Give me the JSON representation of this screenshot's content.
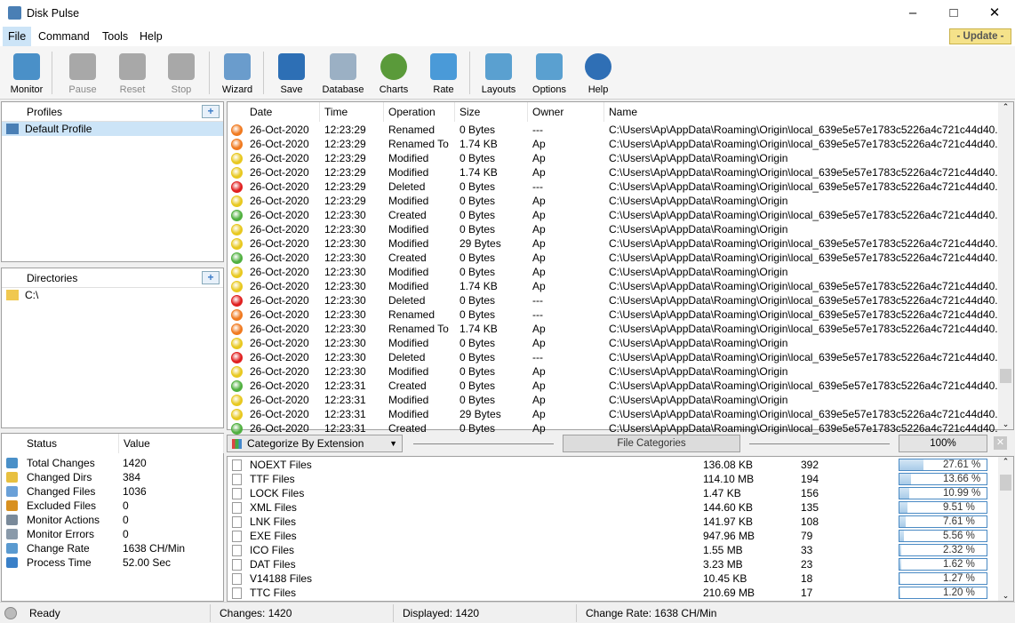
{
  "app": {
    "title": "Disk Pulse",
    "update_label": "- Update -"
  },
  "menu": [
    "File",
    "Command",
    "Tools",
    "Help"
  ],
  "toolbar": [
    {
      "label": "Monitor",
      "icon": "monitor-icon",
      "enabled": true,
      "color": "#4a90c8"
    },
    {
      "label": "Pause",
      "icon": "pause-icon",
      "enabled": false,
      "color": "#a8a8a8"
    },
    {
      "label": "Reset",
      "icon": "reset-icon",
      "enabled": false,
      "color": "#a8a8a8"
    },
    {
      "label": "Stop",
      "icon": "stop-icon",
      "enabled": false,
      "color": "#a8a8a8"
    },
    {
      "label": "Wizard",
      "icon": "wizard-icon",
      "enabled": true,
      "color": "#6a9ccc"
    },
    {
      "label": "Save",
      "icon": "save-icon",
      "enabled": true,
      "color": "#2d6fb5"
    },
    {
      "label": "Database",
      "icon": "database-icon",
      "enabled": true,
      "color": "#9bb0c4"
    },
    {
      "label": "Charts",
      "icon": "charts-icon",
      "enabled": true,
      "color": "#5a9a3a"
    },
    {
      "label": "Rate",
      "icon": "rate-icon",
      "enabled": true,
      "color": "#4a9ad8"
    },
    {
      "label": "Layouts",
      "icon": "layouts-icon",
      "enabled": true,
      "color": "#5aa0d0"
    },
    {
      "label": "Options",
      "icon": "options-icon",
      "enabled": true,
      "color": "#5aa0d0"
    },
    {
      "label": "Help",
      "icon": "help-icon",
      "enabled": true,
      "color": "#2f6fb5"
    }
  ],
  "profiles": {
    "header": "Profiles",
    "items": [
      "Default Profile"
    ]
  },
  "directories": {
    "header": "Directories",
    "items": [
      "C:\\"
    ]
  },
  "status": {
    "headers": [
      "Status",
      "Value"
    ],
    "rows": [
      {
        "k": "Total Changes",
        "v": "1420",
        "c": "#4a90c8"
      },
      {
        "k": "Changed Dirs",
        "v": "384",
        "c": "#e8c040"
      },
      {
        "k": "Changed Files",
        "v": "1036",
        "c": "#6aa0d8"
      },
      {
        "k": "Excluded Files",
        "v": "0",
        "c": "#d89020"
      },
      {
        "k": "Monitor Actions",
        "v": "0",
        "c": "#7a8a9a"
      },
      {
        "k": "Monitor Errors",
        "v": "0",
        "c": "#8a9aaa"
      },
      {
        "k": "Change Rate",
        "v": "1638 CH/Min",
        "c": "#5a9ad0"
      },
      {
        "k": "Process Time",
        "v": "52.00 Sec",
        "c": "#3a80c8"
      }
    ]
  },
  "events": {
    "headers": [
      "Date",
      "Time",
      "Operation",
      "Size",
      "Owner",
      "Name"
    ],
    "colors": {
      "Renamed": "#f07a20",
      "Renamed To": "#f07a20",
      "Modified": "#e8c820",
      "Deleted": "#e02020",
      "Created": "#50b040"
    },
    "rows": [
      [
        "26-Oct-2020",
        "12:23:29",
        "Renamed",
        "0 Bytes",
        "---",
        "C:\\Users\\Ap\\AppData\\Roaming\\Origin\\local_639e5e57e1783c5226a4c721c44d40..."
      ],
      [
        "26-Oct-2020",
        "12:23:29",
        "Renamed To",
        "1.74 KB",
        "Ap",
        "C:\\Users\\Ap\\AppData\\Roaming\\Origin\\local_639e5e57e1783c5226a4c721c44d40..."
      ],
      [
        "26-Oct-2020",
        "12:23:29",
        "Modified",
        "0 Bytes",
        "Ap",
        "C:\\Users\\Ap\\AppData\\Roaming\\Origin"
      ],
      [
        "26-Oct-2020",
        "12:23:29",
        "Modified",
        "1.74 KB",
        "Ap",
        "C:\\Users\\Ap\\AppData\\Roaming\\Origin\\local_639e5e57e1783c5226a4c721c44d40..."
      ],
      [
        "26-Oct-2020",
        "12:23:29",
        "Deleted",
        "0 Bytes",
        "---",
        "C:\\Users\\Ap\\AppData\\Roaming\\Origin\\local_639e5e57e1783c5226a4c721c44d40..."
      ],
      [
        "26-Oct-2020",
        "12:23:29",
        "Modified",
        "0 Bytes",
        "Ap",
        "C:\\Users\\Ap\\AppData\\Roaming\\Origin"
      ],
      [
        "26-Oct-2020",
        "12:23:30",
        "Created",
        "0 Bytes",
        "Ap",
        "C:\\Users\\Ap\\AppData\\Roaming\\Origin\\local_639e5e57e1783c5226a4c721c44d40..."
      ],
      [
        "26-Oct-2020",
        "12:23:30",
        "Modified",
        "0 Bytes",
        "Ap",
        "C:\\Users\\Ap\\AppData\\Roaming\\Origin"
      ],
      [
        "26-Oct-2020",
        "12:23:30",
        "Modified",
        "29 Bytes",
        "Ap",
        "C:\\Users\\Ap\\AppData\\Roaming\\Origin\\local_639e5e57e1783c5226a4c721c44d40..."
      ],
      [
        "26-Oct-2020",
        "12:23:30",
        "Created",
        "0 Bytes",
        "Ap",
        "C:\\Users\\Ap\\AppData\\Roaming\\Origin\\local_639e5e57e1783c5226a4c721c44d40..."
      ],
      [
        "26-Oct-2020",
        "12:23:30",
        "Modified",
        "0 Bytes",
        "Ap",
        "C:\\Users\\Ap\\AppData\\Roaming\\Origin"
      ],
      [
        "26-Oct-2020",
        "12:23:30",
        "Modified",
        "1.74 KB",
        "Ap",
        "C:\\Users\\Ap\\AppData\\Roaming\\Origin\\local_639e5e57e1783c5226a4c721c44d40..."
      ],
      [
        "26-Oct-2020",
        "12:23:30",
        "Deleted",
        "0 Bytes",
        "---",
        "C:\\Users\\Ap\\AppData\\Roaming\\Origin\\local_639e5e57e1783c5226a4c721c44d40..."
      ],
      [
        "26-Oct-2020",
        "12:23:30",
        "Renamed",
        "0 Bytes",
        "---",
        "C:\\Users\\Ap\\AppData\\Roaming\\Origin\\local_639e5e57e1783c5226a4c721c44d40..."
      ],
      [
        "26-Oct-2020",
        "12:23:30",
        "Renamed To",
        "1.74 KB",
        "Ap",
        "C:\\Users\\Ap\\AppData\\Roaming\\Origin\\local_639e5e57e1783c5226a4c721c44d40..."
      ],
      [
        "26-Oct-2020",
        "12:23:30",
        "Modified",
        "0 Bytes",
        "Ap",
        "C:\\Users\\Ap\\AppData\\Roaming\\Origin"
      ],
      [
        "26-Oct-2020",
        "12:23:30",
        "Deleted",
        "0 Bytes",
        "---",
        "C:\\Users\\Ap\\AppData\\Roaming\\Origin\\local_639e5e57e1783c5226a4c721c44d40..."
      ],
      [
        "26-Oct-2020",
        "12:23:30",
        "Modified",
        "0 Bytes",
        "Ap",
        "C:\\Users\\Ap\\AppData\\Roaming\\Origin"
      ],
      [
        "26-Oct-2020",
        "12:23:31",
        "Created",
        "0 Bytes",
        "Ap",
        "C:\\Users\\Ap\\AppData\\Roaming\\Origin\\local_639e5e57e1783c5226a4c721c44d40..."
      ],
      [
        "26-Oct-2020",
        "12:23:31",
        "Modified",
        "0 Bytes",
        "Ap",
        "C:\\Users\\Ap\\AppData\\Roaming\\Origin"
      ],
      [
        "26-Oct-2020",
        "12:23:31",
        "Modified",
        "29 Bytes",
        "Ap",
        "C:\\Users\\Ap\\AppData\\Roaming\\Origin\\local_639e5e57e1783c5226a4c721c44d40..."
      ],
      [
        "26-Oct-2020",
        "12:23:31",
        "Created",
        "0 Bytes",
        "Ap",
        "C:\\Users\\Ap\\AppData\\Roaming\\Origin\\local_639e5e57e1783c5226a4c721c44d40..."
      ]
    ]
  },
  "categories": {
    "select": "Categorize By Extension",
    "title": "File Categories",
    "zoom": "100%",
    "rows": [
      {
        "name": "NOEXT Files",
        "size": "136.08 KB",
        "count": "392",
        "pct": "27.61 %",
        "p": 27.61
      },
      {
        "name": "TTF Files",
        "size": "114.10 MB",
        "count": "194",
        "pct": "13.66 %",
        "p": 13.66
      },
      {
        "name": "LOCK Files",
        "size": "1.47 KB",
        "count": "156",
        "pct": "10.99 %",
        "p": 10.99
      },
      {
        "name": "XML Files",
        "size": "144.60 KB",
        "count": "135",
        "pct": "9.51 %",
        "p": 9.51
      },
      {
        "name": "LNK Files",
        "size": "141.97 KB",
        "count": "108",
        "pct": "7.61 %",
        "p": 7.61
      },
      {
        "name": "EXE Files",
        "size": "947.96 MB",
        "count": "79",
        "pct": "5.56 %",
        "p": 5.56
      },
      {
        "name": "ICO Files",
        "size": "1.55 MB",
        "count": "33",
        "pct": "2.32 %",
        "p": 2.32
      },
      {
        "name": "DAT Files",
        "size": "3.23 MB",
        "count": "23",
        "pct": "1.62 %",
        "p": 1.62
      },
      {
        "name": "V14188 Files",
        "size": "10.45 KB",
        "count": "18",
        "pct": "1.27 %",
        "p": 1.27
      },
      {
        "name": "TTC Files",
        "size": "210.69 MB",
        "count": "17",
        "pct": "1.20 %",
        "p": 1.2
      }
    ]
  },
  "statusbar": {
    "state": "Ready",
    "changes": "Changes: 1420",
    "displayed": "Displayed: 1420",
    "rate": "Change Rate: 1638 CH/Min"
  }
}
